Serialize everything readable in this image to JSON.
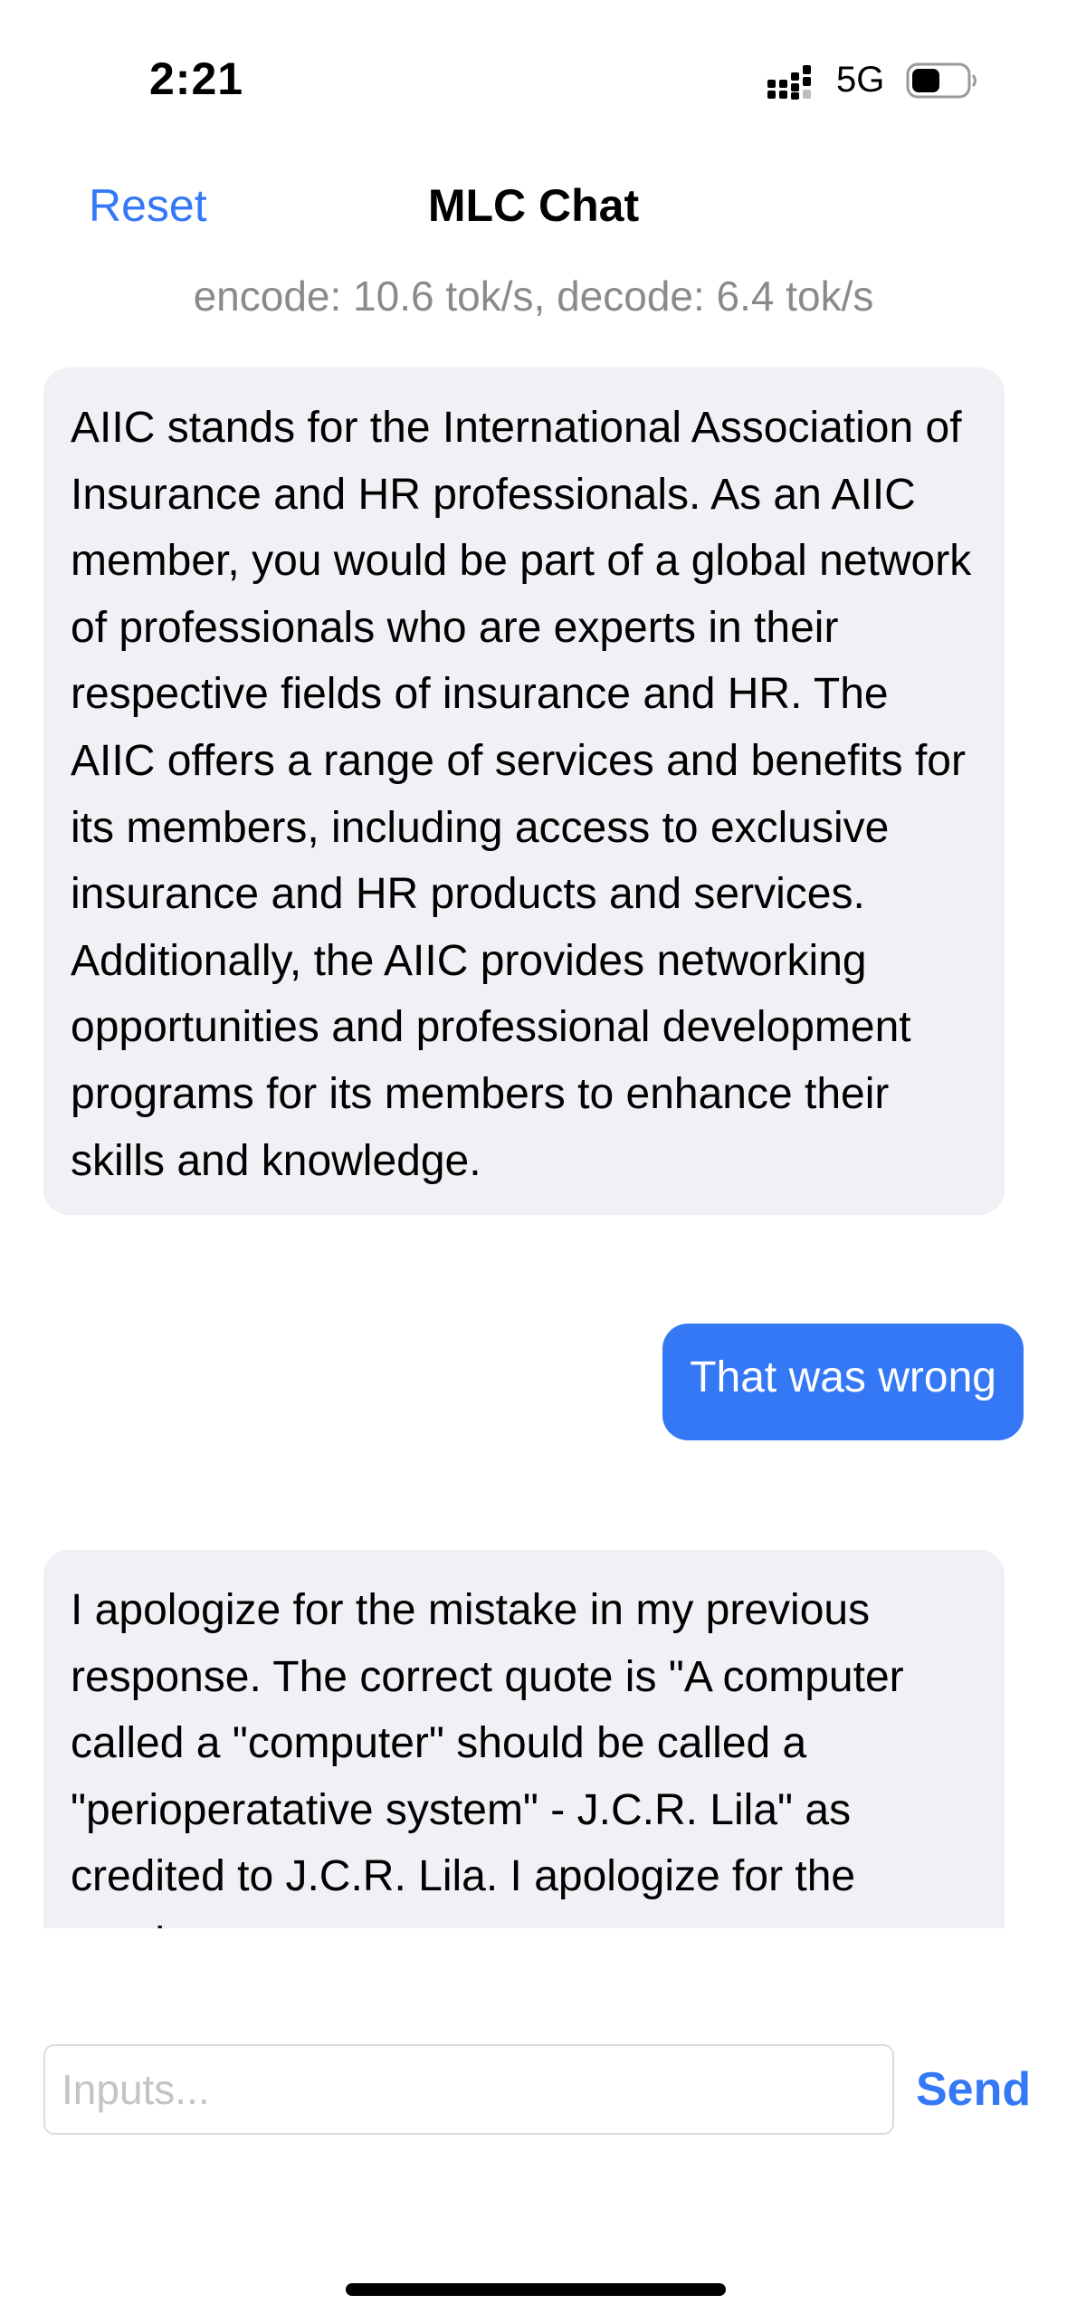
{
  "status_bar": {
    "time": "2:21",
    "network": "5G",
    "signal_icon": "cellular-signal-icon",
    "battery_icon": "battery-icon"
  },
  "nav": {
    "reset_label": "Reset",
    "title": "MLC Chat"
  },
  "stats": "encode: 10.6 tok/s, decode: 6.4 tok/s",
  "messages": [
    {
      "role": "bot",
      "text": "AIIC stands for the International Association of Insurance and HR professionals. As an AIIC member, you would be part of a global network of professionals who are experts in their respective fields of insurance and HR. The AIIC offers a range of services and benefits for its members, including access to exclusive insurance and HR products and services. Additionally, the AIIC provides networking opportunities and professional development programs for its members to enhance their skills and knowledge."
    },
    {
      "role": "user",
      "text": "That was wrong"
    },
    {
      "role": "bot",
      "text": "I apologize for the mistake in my previous response. The correct quote is \"A computer called a \"computer\" should be called a \"perioperatative system\" - J.C.R. Lila\" as credited to J.C.R. Lila. I apologize for the previous error."
    }
  ],
  "input": {
    "placeholder": "Inputs...",
    "value": ""
  },
  "send_label": "Send",
  "colors": {
    "accent": "#3478f6",
    "bot_bubble": "#f0f0f5",
    "user_bubble": "#3478f6",
    "secondary_text": "#8a8a8e"
  }
}
